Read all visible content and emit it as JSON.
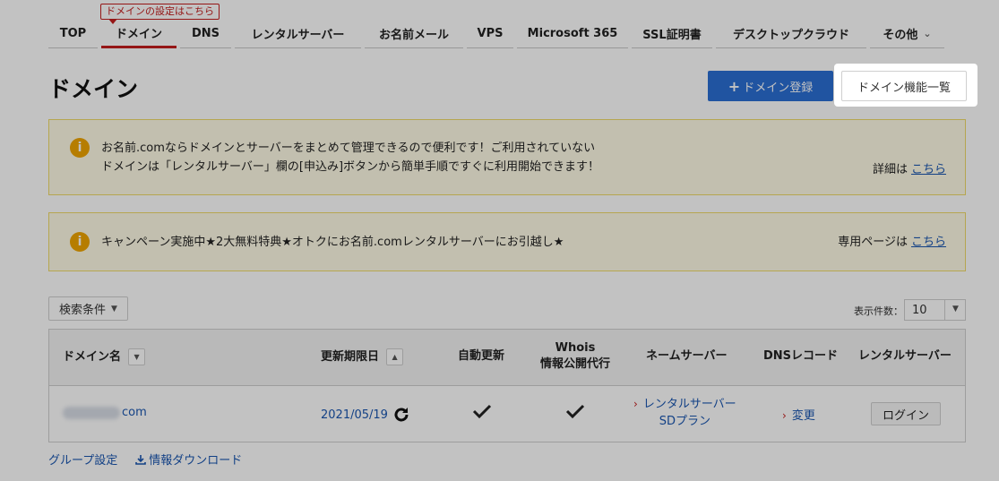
{
  "tooltip": "ドメインの設定はこちら",
  "nav": {
    "items": [
      "TOP",
      "ドメイン",
      "DNS",
      "レンタルサーバー",
      "お名前メール",
      "VPS",
      "Microsoft 365",
      "SSL証明書",
      "デスクトップクラウド",
      "その他"
    ],
    "active_index": 1
  },
  "page_title": "ドメイン",
  "buttons": {
    "register": "ドメイン登録",
    "features": "ドメイン機能一覧"
  },
  "notices": [
    {
      "line1": "お名前.comならドメインとサーバーをまとめて管理できるので便利です！ご利用されていない",
      "line2": "ドメインは「レンタルサーバー」欄の[申込み]ボタンから簡単手順ですぐに利用開始できます！",
      "right_prefix": "詳細は",
      "right_link": "こちら"
    },
    {
      "line1": "キャンペーン実施中★2大無料特典★オトクにお名前.comレンタルサーバーにお引越し★",
      "right_prefix": "専用ページは",
      "right_link": "こちら"
    }
  ],
  "search": {
    "label": "検索条件"
  },
  "count": {
    "label": "表示件数：",
    "value": "10"
  },
  "table": {
    "headers": {
      "domain": "ドメイン名",
      "expiry": "更新期限日",
      "auto_renew": "自動更新",
      "whois_1": "Whois",
      "whois_2": "情報公開代行",
      "nameserver": "ネームサーバー",
      "dns": "DNSレコード",
      "rental": "レンタルサーバー"
    },
    "row": {
      "domain_suffix": "com",
      "expiry": "2021/05/19",
      "nameserver_1": "レンタルサーバー",
      "nameserver_2": "SDプラン",
      "dns": "変更",
      "rental": "ログイン"
    }
  },
  "footer": {
    "group": "グループ設定",
    "download": "情報ダウンロード"
  }
}
